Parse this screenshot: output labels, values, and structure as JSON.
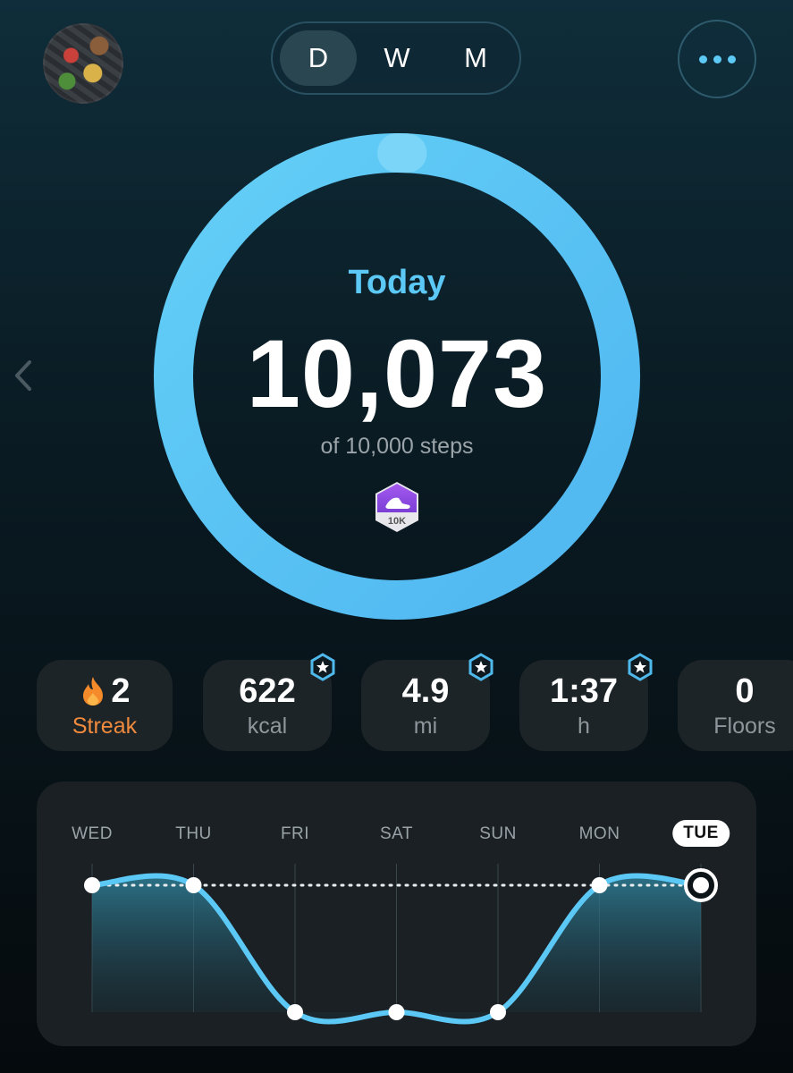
{
  "header": {
    "periods": [
      "D",
      "W",
      "M"
    ],
    "selected_period": "D",
    "avatar": "user-avatar",
    "more_icon": "ellipsis-icon"
  },
  "summary": {
    "label": "Today",
    "steps": "10,073",
    "goal_text": "of 10,000 steps",
    "progress": 1.0073,
    "badge_text": "10K"
  },
  "stats": {
    "streak": {
      "value": "2",
      "label": "Streak",
      "icon": "flame-icon"
    },
    "kcal": {
      "value": "622",
      "label": "kcal",
      "starred": true
    },
    "mi": {
      "value": "4.9",
      "label": "mi",
      "starred": true
    },
    "h": {
      "value": "1:37",
      "label": "h",
      "starred": true
    },
    "floors": {
      "value": "0",
      "label": "Floors"
    }
  },
  "colors": {
    "accent": "#5cc8f5",
    "streak": "#f08a3c",
    "badge": "#8e4fe0"
  },
  "chart_data": {
    "type": "area",
    "categories": [
      "WED",
      "THU",
      "FRI",
      "SAT",
      "SUN",
      "MON",
      "TUE"
    ],
    "selected": "TUE",
    "values": [
      1.0,
      1.0,
      0.0,
      0.0,
      0.0,
      1.0,
      1.0
    ],
    "goal_line": 1.0,
    "ylim": [
      0,
      1
    ]
  }
}
